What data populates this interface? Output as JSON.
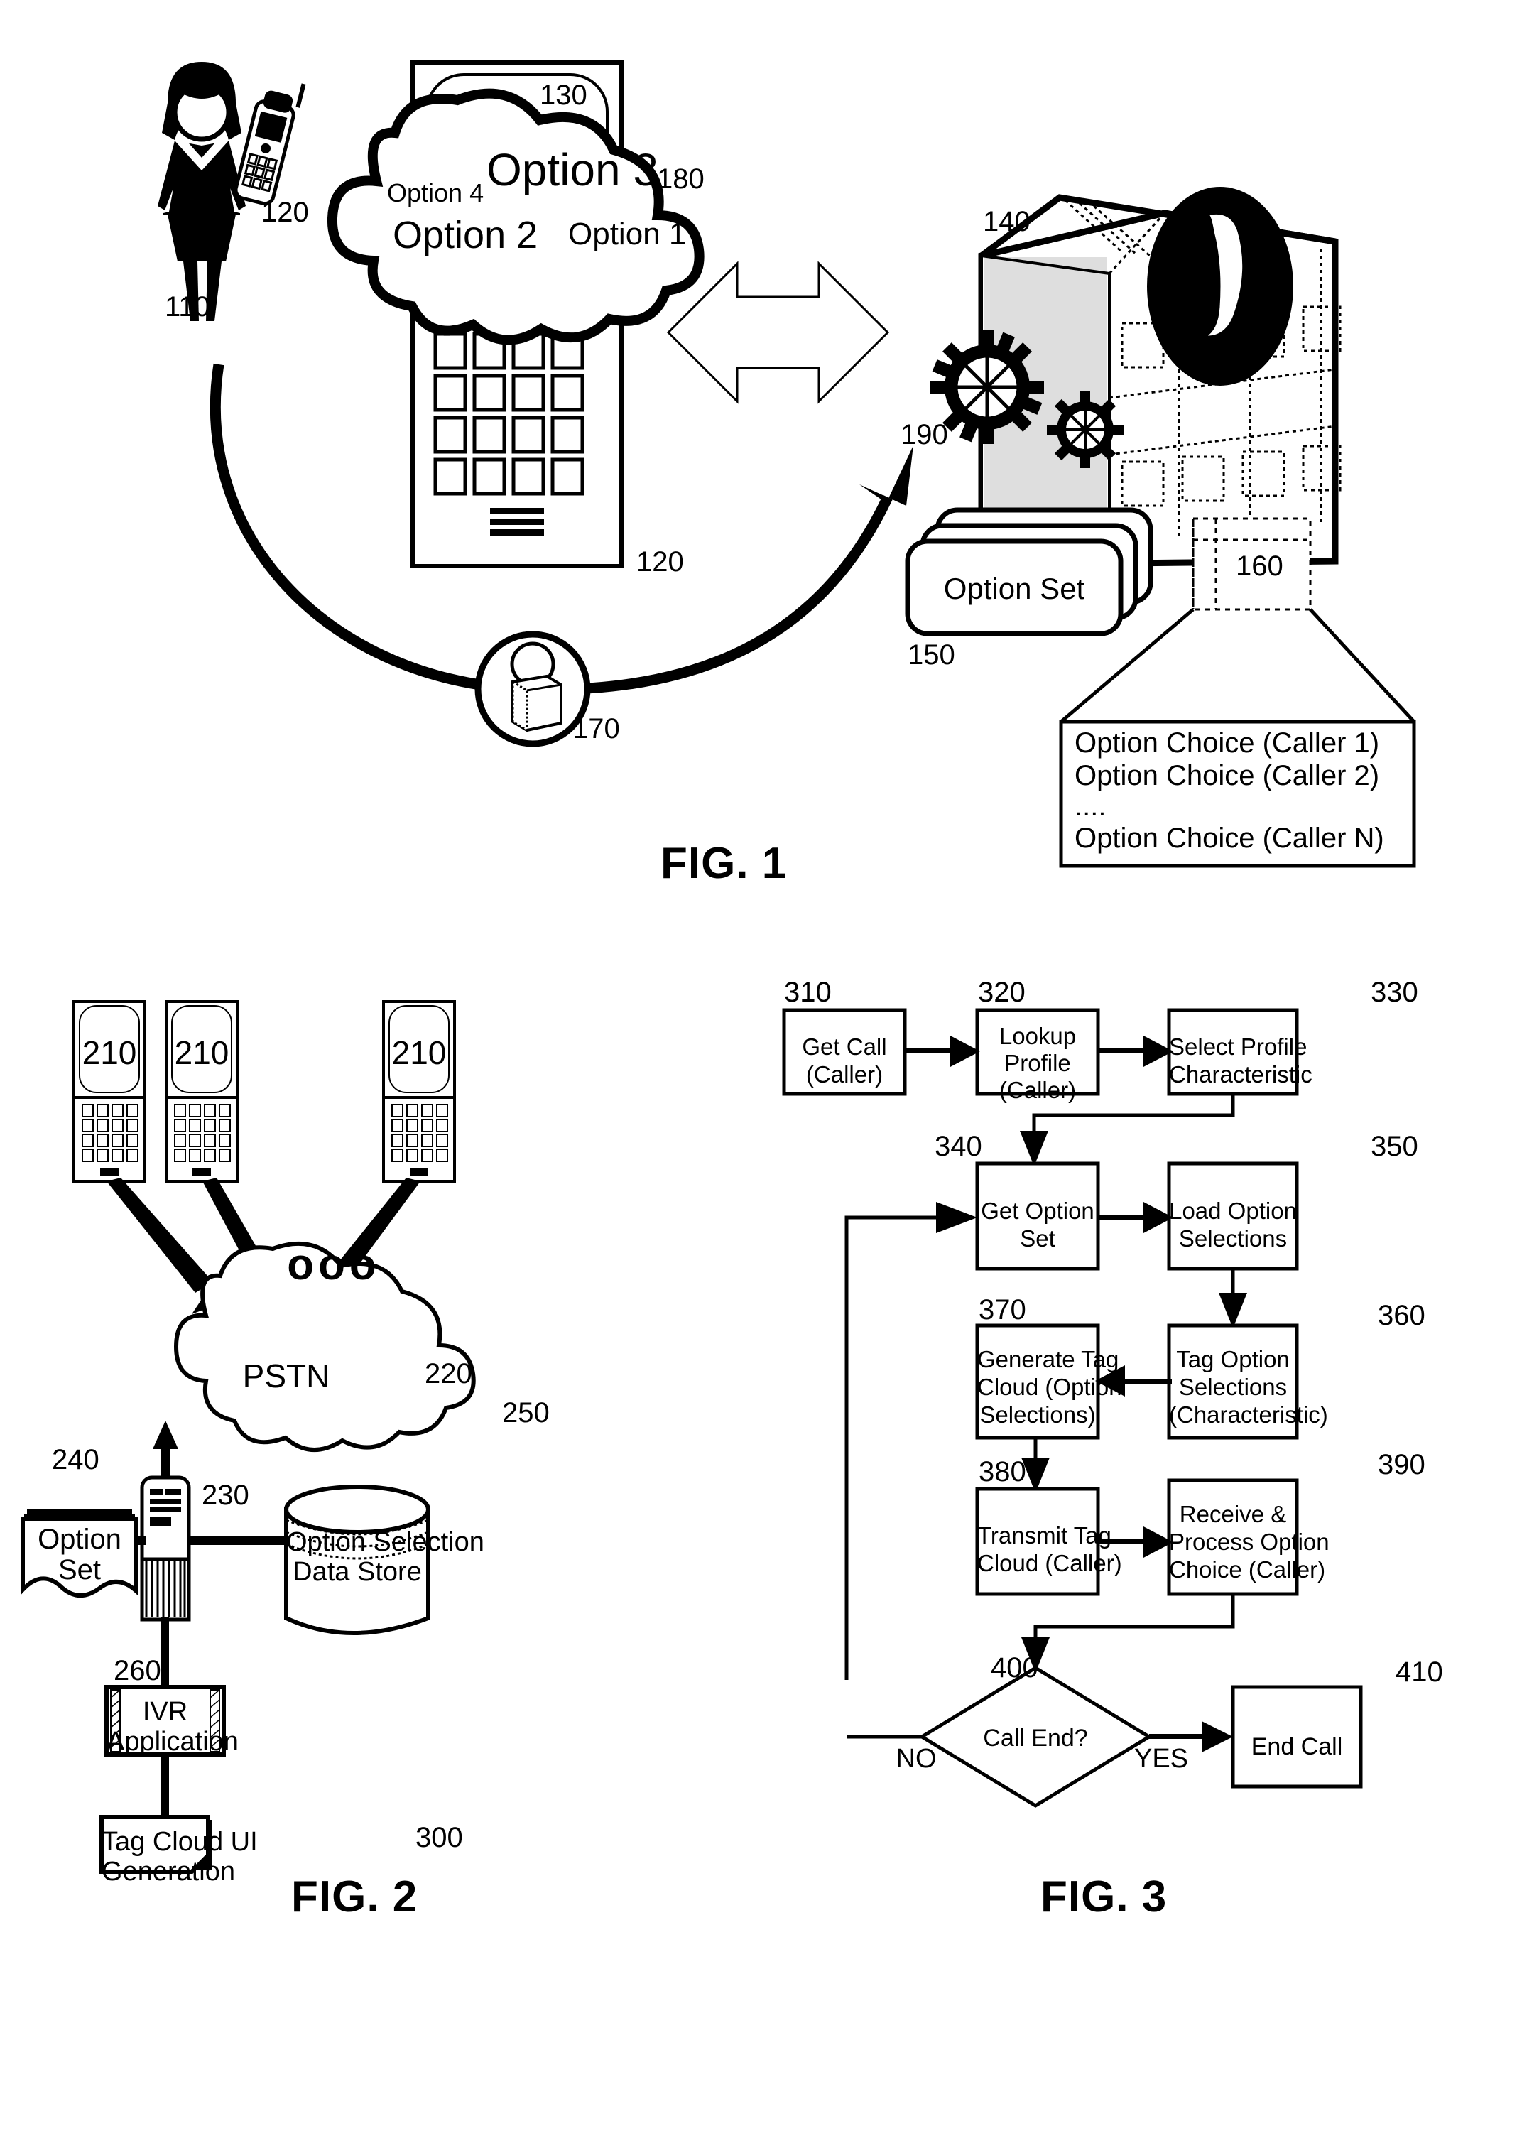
{
  "figures": [
    {
      "id": "fig1",
      "caption": "FIG. 1"
    },
    {
      "id": "fig2",
      "caption": "FIG. 2"
    },
    {
      "id": "fig3",
      "caption": "FIG. 3"
    }
  ],
  "fig1": {
    "caption": "FIG. 1",
    "reference_numerals": {
      "caller": "110",
      "handset": "120",
      "phone_device": "120",
      "phone_screen": "130",
      "ivr_server": "140",
      "option_sets": "150",
      "option_choices": "160",
      "profile": "170",
      "tag_cloud": "180",
      "gears": "190"
    },
    "tag_cloud": {
      "label": "180",
      "screen_label": "130",
      "tags": [
        {
          "text": "Option 4",
          "weight": "small"
        },
        {
          "text": "Option 3",
          "weight": "xlarge"
        },
        {
          "text": "Option 2",
          "weight": "large"
        },
        {
          "text": "Option 1",
          "weight": "medium"
        }
      ]
    },
    "option_set_card": {
      "label": "Option Set",
      "numeral": "150"
    },
    "option_choice_box": {
      "numeral": "160",
      "lines": [
        "Option Choice (Caller 1)",
        "Option Choice (Caller 2)",
        "....",
        "Option Choice (Caller N)"
      ]
    }
  },
  "fig2": {
    "caption": "FIG. 2",
    "phones": [
      {
        "screen_label": "210"
      },
      {
        "screen_label": "210"
      },
      {
        "screen_label": "210"
      }
    ],
    "ellipsis": "ooo",
    "network_cloud": {
      "label": "PSTN",
      "numeral": "220"
    },
    "server": {
      "numeral": "230"
    },
    "option_set_doc": {
      "lines": [
        "Option",
        "Set"
      ],
      "numeral": "240"
    },
    "data_store": {
      "lines": [
        "Option Selection",
        "Data Store"
      ],
      "numeral": "250"
    },
    "ivr_application": {
      "lines": [
        "IVR",
        "Application"
      ],
      "numeral": "260"
    },
    "tag_cloud_ui": {
      "lines": [
        "Tag Cloud UI",
        "Generation"
      ],
      "numeral": "300"
    }
  },
  "fig3": {
    "caption": "FIG. 3",
    "nodes": [
      {
        "numeral": "310",
        "lines": [
          "Get Call",
          "(Caller)"
        ],
        "shape": "rect"
      },
      {
        "numeral": "320",
        "lines": [
          "Lookup",
          "Profile",
          "(Caller)"
        ],
        "shape": "rect"
      },
      {
        "numeral": "330",
        "lines": [
          "Select Profile",
          "Characteristic"
        ],
        "shape": "rect"
      },
      {
        "numeral": "340",
        "lines": [
          "Get Option",
          "Set"
        ],
        "shape": "rect"
      },
      {
        "numeral": "350",
        "lines": [
          "Load Option",
          "Selections"
        ],
        "shape": "rect"
      },
      {
        "numeral": "360",
        "lines": [
          "Tag Option",
          "Selections",
          "(Characteristic)"
        ],
        "shape": "rect"
      },
      {
        "numeral": "370",
        "lines": [
          "Generate Tag",
          "Cloud (Option",
          "Selections)"
        ],
        "shape": "rect"
      },
      {
        "numeral": "380",
        "lines": [
          "Transmit Tag",
          "Cloud (Caller)"
        ],
        "shape": "rect"
      },
      {
        "numeral": "390",
        "lines": [
          "Receive &",
          "Process Option",
          "Choice (Caller)"
        ],
        "shape": "rect"
      },
      {
        "numeral": "400",
        "lines": [
          "Call End?"
        ],
        "shape": "diamond"
      },
      {
        "numeral": "410",
        "lines": [
          "End Call"
        ],
        "shape": "rect"
      }
    ],
    "edge_labels": {
      "no": "NO",
      "yes": "YES"
    }
  },
  "colors": {
    "ink": "#000000",
    "paper": "#ffffff",
    "hatch": "#808080"
  }
}
